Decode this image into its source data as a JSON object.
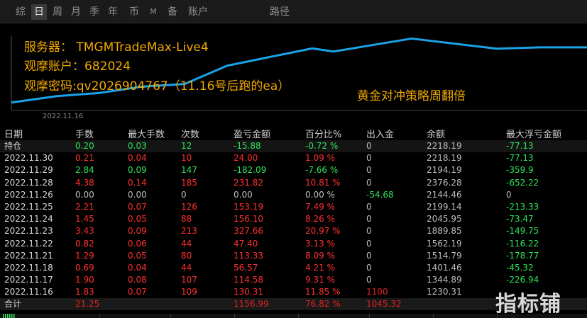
{
  "tabs": [
    {
      "label": "综",
      "active": false
    },
    {
      "label": "日",
      "active": true
    },
    {
      "label": "周",
      "active": false
    },
    {
      "label": "月",
      "active": false
    },
    {
      "label": "季",
      "active": false
    },
    {
      "label": "年",
      "active": false
    },
    {
      "label": "币",
      "active": false
    },
    {
      "label": "M",
      "active": false
    },
    {
      "label": "备",
      "active": false
    },
    {
      "label": "账户",
      "active": false
    },
    {
      "label": "路径",
      "active": false
    }
  ],
  "overlay": {
    "server": "服务器：   TMGMTradeMax-Live4",
    "account": "观摩账户：682024",
    "password": "观摩密码:qv2026904767（11.16号后跑的ea）",
    "strategy": "黄金对冲策略周翻倍"
  },
  "chart_data": {
    "type": "line",
    "x_start_label": "2022.11.16",
    "color": "#1aa3e8",
    "values": [
      1230.31,
      1344.89,
      1401.46,
      1514.79,
      1562.19,
      1889.85,
      2045.95,
      2199.14,
      2144.46,
      2376.28,
      2194.19,
      2218.19,
      2218.19
    ]
  },
  "table": {
    "headers": [
      "日期",
      "手数",
      "最大手数",
      "次数",
      "盈亏金额",
      "百分比%",
      "出入金",
      "余额",
      "最大浮亏金额"
    ],
    "position_row": [
      "持仓",
      "0.20",
      "0.03",
      "12",
      "-15.88",
      "-0.72 %",
      "0",
      "2218.19",
      "-77.13"
    ],
    "rows": [
      [
        "2022.11.30",
        "0.21",
        "0.04",
        "10",
        "24.00",
        "1.09 %",
        "0",
        "2218.19",
        "-77.13"
      ],
      [
        "2022.11.29",
        "2.84",
        "0.09",
        "147",
        "-182.09",
        "-7.66 %",
        "0",
        "2194.19",
        "-359.9"
      ],
      [
        "2022.11.28",
        "4.38",
        "0.14",
        "185",
        "231.82",
        "10.81 %",
        "0",
        "2376.28",
        "-652.22"
      ],
      [
        "2022.11.26",
        "0.00",
        "0.00",
        "0",
        "0.00",
        "0.00 %",
        "-54.68",
        "2144.46",
        "0"
      ],
      [
        "2022.11.25",
        "2.21",
        "0.07",
        "126",
        "153.19",
        "7.49 %",
        "0",
        "2199.14",
        "-213.33"
      ],
      [
        "2022.11.24",
        "1.45",
        "0.05",
        "88",
        "156.10",
        "8.26 %",
        "0",
        "2045.95",
        "-73.47"
      ],
      [
        "2022.11.23",
        "3.43",
        "0.09",
        "213",
        "327.66",
        "20.97 %",
        "0",
        "1889.85",
        "-149.75"
      ],
      [
        "2022.11.22",
        "0.82",
        "0.06",
        "44",
        "47.40",
        "3.13 %",
        "0",
        "1562.19",
        "-116.22"
      ],
      [
        "2022.11.21",
        "1.29",
        "0.05",
        "80",
        "113.33",
        "8.09 %",
        "0",
        "1514.79",
        "-178.77"
      ],
      [
        "2022.11.18",
        "0.69",
        "0.04",
        "44",
        "56.57",
        "4.21 %",
        "0",
        "1401.46",
        "-45.32"
      ],
      [
        "2022.11.17",
        "1.90",
        "0.08",
        "107",
        "114.58",
        "9.31 %",
        "0",
        "1344.89",
        "-226.94"
      ],
      [
        "2022.11.16",
        "1.83",
        "0.07",
        "109",
        "130.31",
        "11.85 %",
        "1100",
        "1230.31",
        ""
      ]
    ],
    "total_row": [
      "合计",
      "21.25",
      "",
      "",
      "1156.99",
      "76.82 %",
      "1045.32",
      "",
      ""
    ]
  },
  "watermark": "指标铺",
  "colors": {
    "profit": "#e02020",
    "loss": "#2fe35a",
    "overlay": "#f0a800",
    "line": "#1aa3e8"
  }
}
